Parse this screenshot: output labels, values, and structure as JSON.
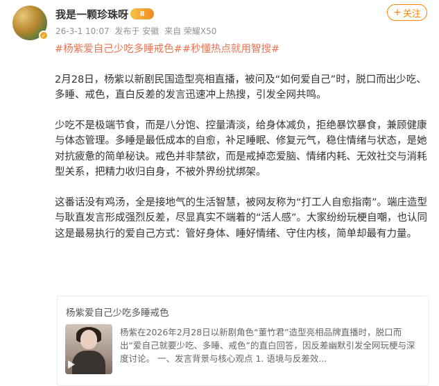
{
  "post": {
    "username": "我是一颗珍珠呀",
    "vip_level": "Ⅱ",
    "date": "26-3-1 10:07",
    "location": "发布于 安徽",
    "device": "来自 荣耀X50",
    "follow_label": "关注",
    "tags": [
      "#杨紫爱自己少吃多睡戒色#",
      "#秒懂热点就用智搜#"
    ],
    "paragraphs": [
      "2月28日，杨紫以新剧民国造型亮相直播，被问及“如何爱自己”时，脱口而出少吃、多睡、戒色，直白反差的发言迅速冲上热搜，引发全网共鸣。",
      "少吃不是极端节食，而是八分饱、控量清淡，给身体减负，拒绝暴饮暴食，兼顾健康与体态管理。多睡是最低成本的自愈，补足睡眠、修复元气，稳住情绪与状态，是她对抗疲惫的简单秘诀。戒色并非禁欲，而是戒掉恋爱脑、情绪内耗、无效社交与消耗型关系，把精力收归自身，不被外界纷扰绑架。",
      "这番话没有鸡汤，全是接地气的生活智慧，被网友称为“打工人自愈指南”。端庄造型与耿直发言形成强烈反差，尽显真实不端着的“活人感”。大家纷纷玩梗自嘲，也认同这是最易执行的爱自己方式：管好身体、睡好情绪、守住内核，简单却最有力量。"
    ]
  },
  "card": {
    "title": "杨紫爱自己少吃多睡戒色",
    "summary": "杨紫在2026年2月28日以新剧角色“董竹君”造型亮相品牌直播时，脱口而出“爱自己就要少吃、多睡、戒色”的直白回答，因反差幽默引发全网玩梗与深度讨论。 一、发言背景与核心观点 1. 语境与反差效..."
  },
  "colors": {
    "accent": "#ff8200",
    "tag": "#eb7350",
    "meta": "#939393"
  },
  "icons": {
    "verified": "verified-badge-icon",
    "vip": "vip-level-icon",
    "plus": "plus-icon",
    "play": "play-icon"
  }
}
